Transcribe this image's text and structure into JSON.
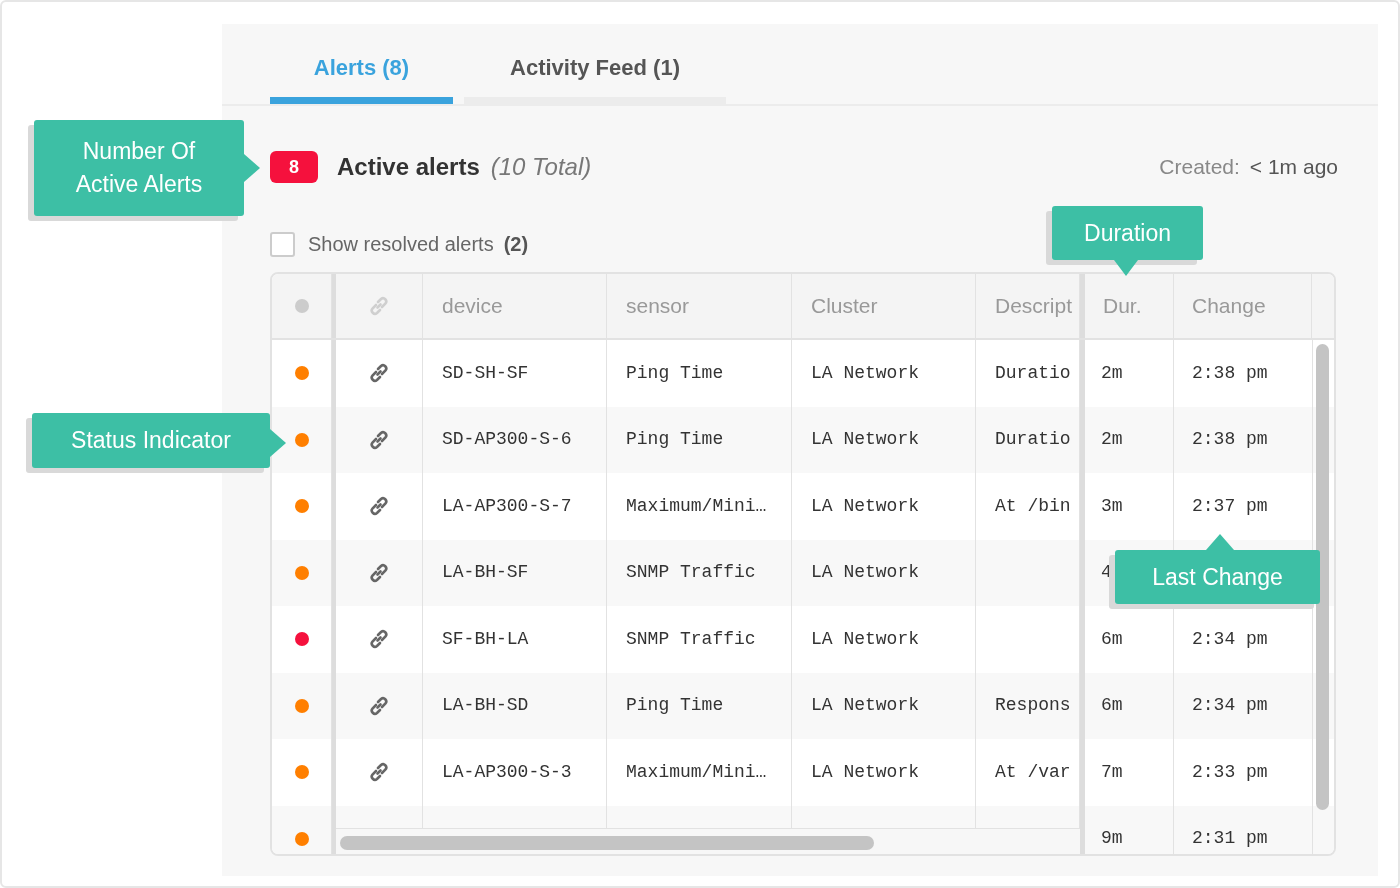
{
  "tabs": [
    {
      "label": "Alerts (8)",
      "selected": true
    },
    {
      "label": "Activity Feed (1)",
      "selected": false
    }
  ],
  "summary": {
    "badge": "8",
    "title": "Active alerts",
    "total": "(10 Total)",
    "created_label": "Created:",
    "created_value": "< 1m ago"
  },
  "show_resolved": {
    "label": "Show resolved alerts",
    "count": "(2)",
    "checked": false
  },
  "table": {
    "columns": [
      "device",
      "sensor",
      "Cluster",
      "Descript",
      "Dur.",
      "Change"
    ],
    "rows": [
      {
        "color": "#ff7f00",
        "device": "SD-SH-SF",
        "sensor": "Ping Time",
        "cluster": "LA Network",
        "description": "Duratio",
        "duration": "2m",
        "change": "2:38 pm"
      },
      {
        "color": "#ff7f00",
        "device": "SD-AP300-S-6",
        "sensor": "Ping Time",
        "cluster": "LA Network",
        "description": "Duratio",
        "duration": "2m",
        "change": "2:38 pm"
      },
      {
        "color": "#ff7f00",
        "device": "LA-AP300-S-7",
        "sensor": "Maximum/Mini…",
        "cluster": "LA Network",
        "description": "At /bin",
        "duration": "3m",
        "change": "2:37 pm"
      },
      {
        "color": "#ff7f00",
        "device": "LA-BH-SF",
        "sensor": "SNMP Traffic",
        "cluster": "LA Network",
        "duration": "4"
      },
      {
        "color": "#f5113d",
        "device": "SF-BH-LA",
        "sensor": "SNMP Traffic",
        "cluster": "LA Network",
        "duration": "6m",
        "change": "2:34 pm"
      },
      {
        "color": "#ff7f00",
        "device": "LA-BH-SD",
        "sensor": "Ping Time",
        "cluster": "LA Network",
        "description": "Respons",
        "duration": "6m",
        "change": "2:34 pm"
      },
      {
        "color": "#ff7f00",
        "device": "LA-AP300-S-3",
        "sensor": "Maximum/Mini…",
        "cluster": "LA Network",
        "description": "At /var",
        "duration": "7m",
        "change": "2:33 pm"
      },
      {
        "color": "#ff7f00",
        "duration": "9m",
        "change": "2:31 pm"
      }
    ]
  },
  "callouts": [
    {
      "text": "Number Of Active Alerts",
      "kind": "right"
    },
    {
      "text": "Status Indicator",
      "kind": "right"
    },
    {
      "text": "Duration",
      "kind": "down"
    },
    {
      "text": "Last Change",
      "kind": "up"
    }
  ]
}
